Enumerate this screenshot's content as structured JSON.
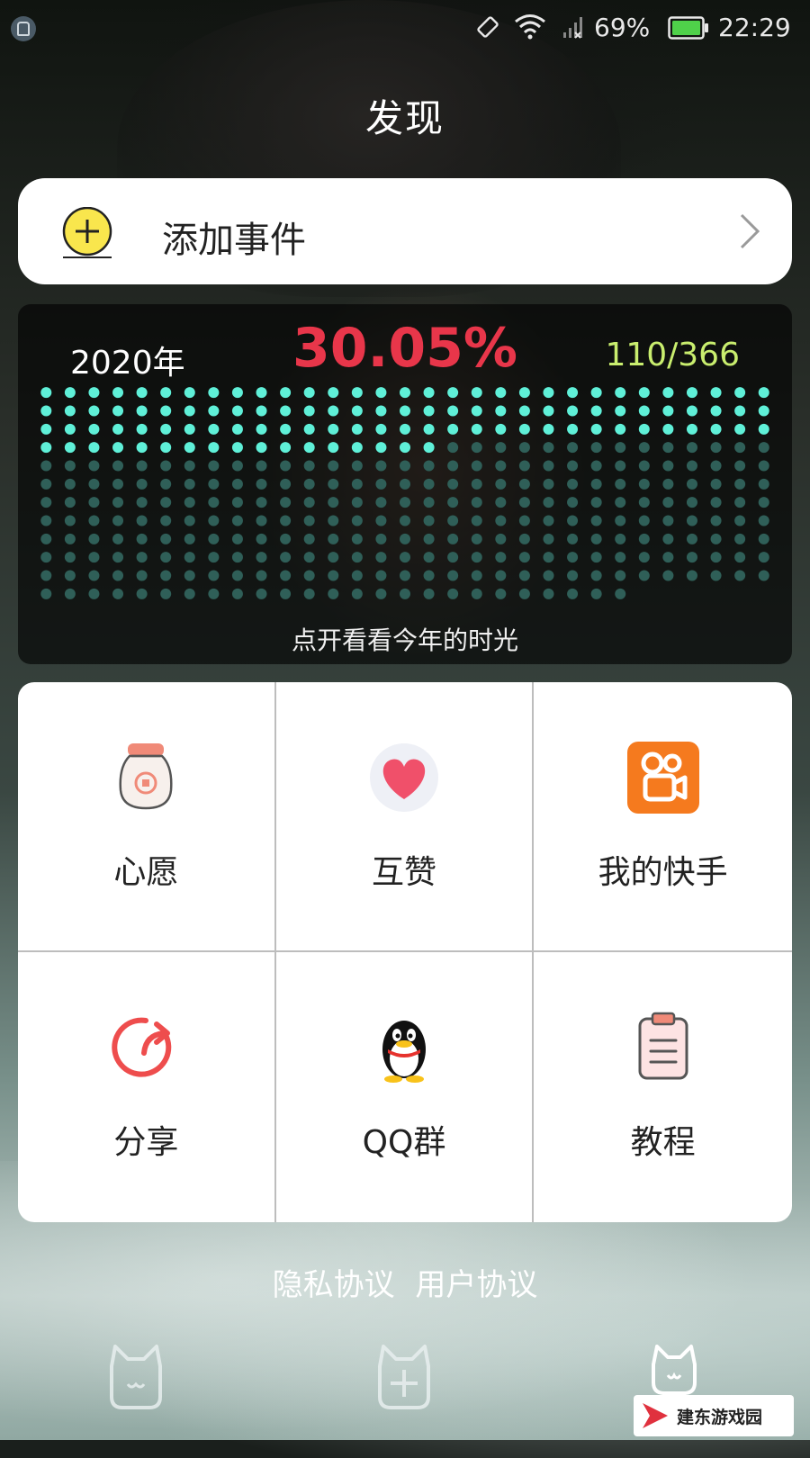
{
  "status_bar": {
    "battery_percent": "69%",
    "time": "22:29"
  },
  "header": {
    "title": "发现"
  },
  "add_event": {
    "label": "添加事件",
    "icon": "plus-circle-icon"
  },
  "year_progress": {
    "year_label": "2020年",
    "percent": "30.05%",
    "day_count": "110/366",
    "days_elapsed": 110,
    "days_total": 366,
    "hint": "点开看看今年的时光",
    "colors": {
      "elapsed": "#5ff0d8",
      "remaining": "#2f5f58",
      "percent": "#e8364a",
      "count": "#c9ee6e"
    }
  },
  "menu": {
    "items": [
      {
        "label": "心愿",
        "icon": "wish-jar-icon"
      },
      {
        "label": "互赞",
        "icon": "heart-icon"
      },
      {
        "label": "我的快手",
        "icon": "kuaishou-icon"
      },
      {
        "label": "分享",
        "icon": "share-icon"
      },
      {
        "label": "QQ群",
        "icon": "qq-penguin-icon"
      },
      {
        "label": "教程",
        "icon": "clipboard-icon"
      }
    ]
  },
  "footer_links": {
    "privacy": "隐私协议",
    "user_agreement": "用户协议"
  },
  "bottom_nav": {
    "items": [
      {
        "icon": "cat-home-icon"
      },
      {
        "icon": "cat-add-icon"
      },
      {
        "icon": "cat-profile-icon"
      }
    ]
  },
  "watermark": {
    "text": "建东游戏园"
  }
}
